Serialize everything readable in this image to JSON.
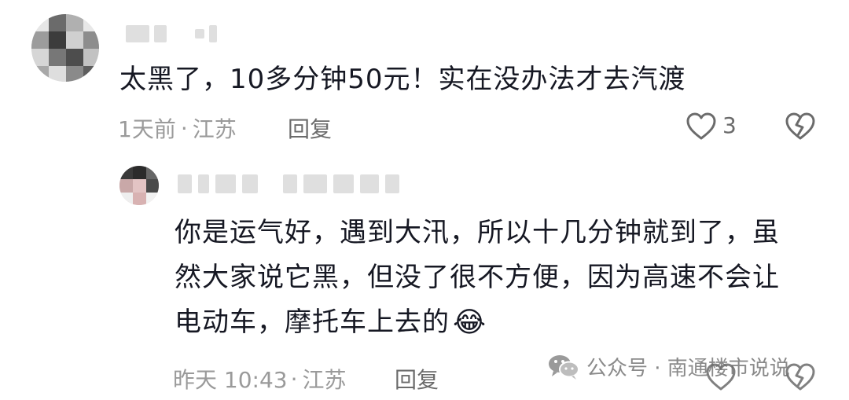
{
  "comment": {
    "text": "太黑了，10多分钟50元！实在没办法才去汽渡",
    "time": "1天前",
    "separator": "·",
    "location": "江苏",
    "reply_label": "回复",
    "like_count": "3",
    "icons": [
      "heart-icon",
      "broken-heart-icon"
    ]
  },
  "reply": {
    "lines": [
      "你是运气好，遇到大汛，所以十几分钟就到了，虽",
      "然大家说它黑，但没了很不方便，因为高速不会让",
      "电动车，摩托车上去的"
    ],
    "emoji": "😂",
    "time": "昨天 10:43",
    "separator": "·",
    "location": "江苏",
    "reply_label": "回复",
    "icons": [
      "heart-icon",
      "broken-heart-icon"
    ]
  },
  "watermark": {
    "text": "公众号 · 南通楼市说说",
    "icon": "wechat-icon"
  },
  "colors": {
    "text": "#161823",
    "meta": "#9a9a9a",
    "action": "#6b6b6b"
  }
}
